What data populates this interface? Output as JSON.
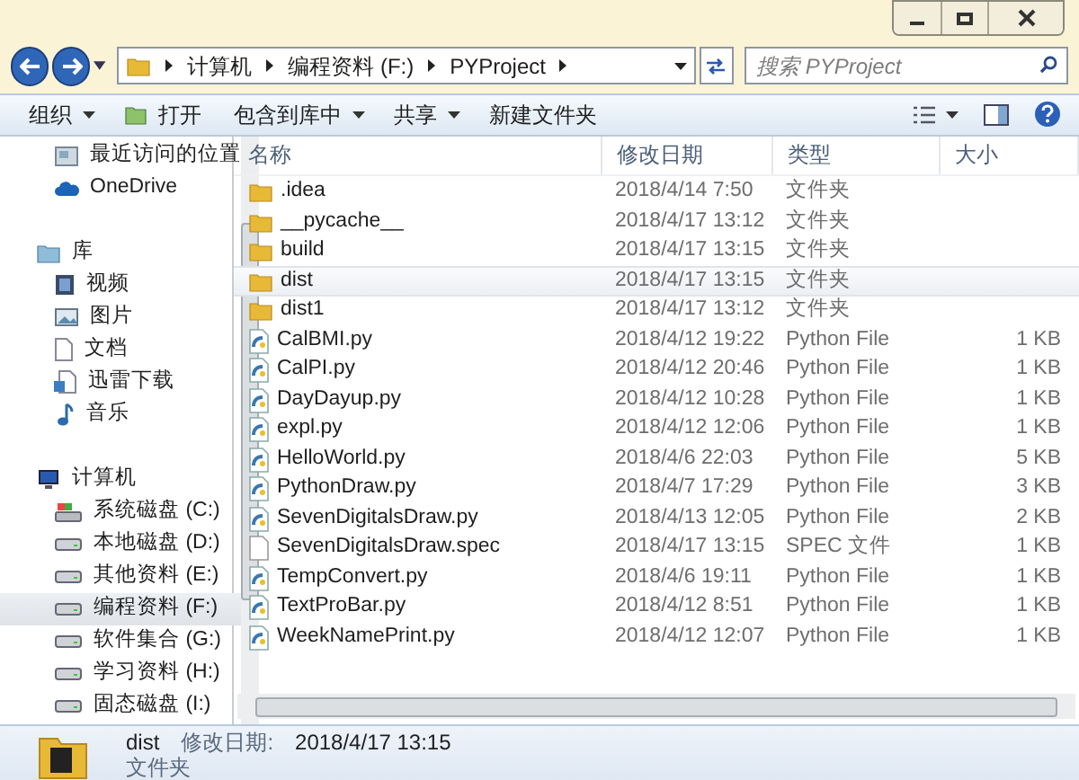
{
  "address": {
    "segments": [
      "计算机",
      "编程资料 (F:)",
      "PYProject"
    ]
  },
  "search": {
    "placeholder": "搜索 PYProject"
  },
  "toolbar": [
    "组织",
    "打开",
    "包含到库中",
    "共享",
    "新建文件夹"
  ],
  "sidebar": {
    "items": [
      {
        "label": "最近访问的位置",
        "kind": "recent",
        "selected": false
      },
      {
        "label": "OneDrive",
        "kind": "cloud",
        "selected": false
      },
      {
        "label": "库",
        "kind": "library",
        "selected": false,
        "group": true
      },
      {
        "label": "视频",
        "kind": "video",
        "selected": false
      },
      {
        "label": "图片",
        "kind": "picture",
        "selected": false
      },
      {
        "label": "文档",
        "kind": "document",
        "selected": false
      },
      {
        "label": "迅雷下载",
        "kind": "download",
        "selected": false
      },
      {
        "label": "音乐",
        "kind": "music",
        "selected": false
      },
      {
        "label": "计算机",
        "kind": "computer",
        "selected": false,
        "group": true
      },
      {
        "label": "系统磁盘 (C:)",
        "kind": "system-drive",
        "selected": false
      },
      {
        "label": "本地磁盘 (D:)",
        "kind": "drive",
        "selected": false
      },
      {
        "label": "其他资料 (E:)",
        "kind": "drive",
        "selected": false
      },
      {
        "label": "编程资料 (F:)",
        "kind": "drive",
        "selected": true
      },
      {
        "label": "软件集合 (G:)",
        "kind": "drive",
        "selected": false
      },
      {
        "label": "学习资料 (H:)",
        "kind": "drive",
        "selected": false
      },
      {
        "label": "固态磁盘 (I:)",
        "kind": "drive",
        "selected": false
      }
    ]
  },
  "table": {
    "columns": [
      "名称",
      "修改日期",
      "类型",
      "大小"
    ],
    "rows": [
      {
        "name": ".idea",
        "date": "2018/4/14 7:50",
        "type": "文件夹",
        "kind": "folder",
        "selected": false
      },
      {
        "name": "__pycache__",
        "date": "2018/4/17 13:12",
        "type": "文件夹",
        "kind": "folder",
        "selected": false
      },
      {
        "name": "build",
        "date": "2018/4/17 13:15",
        "type": "文件夹",
        "kind": "folder",
        "selected": false
      },
      {
        "name": "dist",
        "date": "2018/4/17 13:15",
        "type": "文件夹",
        "kind": "folder",
        "selected": true
      },
      {
        "name": "dist1",
        "date": "2018/4/17 13:12",
        "type": "文件夹",
        "kind": "folder",
        "selected": false
      },
      {
        "name": "CalBMI.py",
        "date": "2018/4/12 19:22",
        "type": "Python File",
        "size": "1 KB",
        "kind": "python",
        "selected": false
      },
      {
        "name": "CalPI.py",
        "date": "2018/4/12 20:46",
        "type": "Python File",
        "size": "1 KB",
        "kind": "python",
        "selected": false
      },
      {
        "name": "DayDayup.py",
        "date": "2018/4/12 10:28",
        "type": "Python File",
        "size": "1 KB",
        "kind": "python",
        "selected": false
      },
      {
        "name": "expl.py",
        "date": "2018/4/12 12:06",
        "type": "Python File",
        "size": "1 KB",
        "kind": "python",
        "selected": false
      },
      {
        "name": "HelloWorld.py",
        "date": "2018/4/6 22:03",
        "type": "Python File",
        "size": "5 KB",
        "kind": "python",
        "selected": false
      },
      {
        "name": "PythonDraw.py",
        "date": "2018/4/7 17:29",
        "type": "Python File",
        "size": "3 KB",
        "kind": "python",
        "selected": false
      },
      {
        "name": "SevenDigitalsDraw.py",
        "date": "2018/4/13 12:05",
        "type": "Python File",
        "size": "2 KB",
        "kind": "python",
        "selected": false
      },
      {
        "name": "SevenDigitalsDraw.spec",
        "date": "2018/4/17 13:15",
        "type": "SPEC 文件",
        "size": "1 KB",
        "kind": "file",
        "selected": false
      },
      {
        "name": "TempConvert.py",
        "date": "2018/4/6 19:11",
        "type": "Python File",
        "size": "1 KB",
        "kind": "python",
        "selected": false
      },
      {
        "name": "TextProBar.py",
        "date": "2018/4/12 8:51",
        "type": "Python File",
        "size": "1 KB",
        "kind": "python",
        "selected": false
      },
      {
        "name": "WeekNamePrint.py",
        "date": "2018/4/12 12:07",
        "type": "Python File",
        "size": "1 KB",
        "kind": "python",
        "selected": false
      }
    ]
  },
  "details": {
    "name": "dist",
    "date_label": "修改日期:",
    "date": "2018/4/17 13:15",
    "type": "文件夹"
  }
}
